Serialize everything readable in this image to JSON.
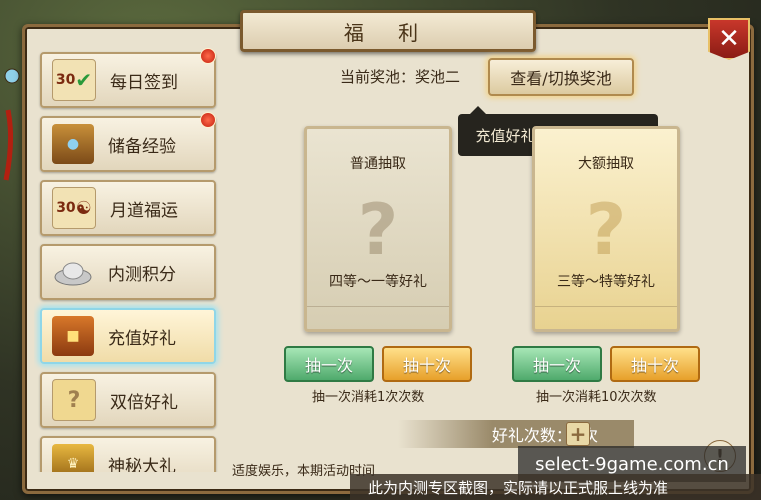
{
  "title": "福 利",
  "close_label": "✕",
  "sidebar": {
    "items": [
      {
        "label": "每日签到",
        "icon": "calendar-check-icon",
        "icon_text": "30",
        "badge": true
      },
      {
        "label": "储备经验",
        "icon": "treasure-chest-icon",
        "icon_text": "",
        "badge": true
      },
      {
        "label": "月道福运",
        "icon": "calendar-yinyang-icon",
        "icon_text": "30",
        "badge": false
      },
      {
        "label": "内测积分",
        "icon": "silver-ingot-icon",
        "icon_text": "",
        "badge": false
      },
      {
        "label": "充值好礼",
        "icon": "gift-chest-icon",
        "icon_text": "",
        "badge": false,
        "active": true
      },
      {
        "label": "双倍好礼",
        "icon": "question-card-icon",
        "icon_text": "?",
        "badge": false
      },
      {
        "label": "神秘大礼",
        "icon": "trophy-chest-icon",
        "icon_text": "",
        "badge": false
      }
    ]
  },
  "pool": {
    "current_label": "当前奖池：奖池二",
    "switch_button": "查看/切换奖池",
    "tooltip": "充值好礼奖池可随心切换"
  },
  "cards": [
    {
      "title": "普通抽取",
      "mark": "?",
      "subtitle": "四等～一等好礼"
    },
    {
      "title": "大额抽取",
      "mark": "?",
      "subtitle": "三等～特等好礼"
    }
  ],
  "buttons": {
    "draw_once": "抽一次",
    "draw_ten": "抽十次"
  },
  "costs": [
    "抽一次消耗1次次数",
    "抽一次消耗10次次数"
  ],
  "gift_count": "好礼次数：0次",
  "plus_label": "+",
  "info_label": "!",
  "footer_text": "适度娱乐，本期活动时间",
  "watermark": "select-9game.com.cn",
  "notice": "此为内测专区截图，实际请以正式服上线为准",
  "colors": {
    "frame": "#e9e2cf",
    "border": "#8b6a3e",
    "active_glow": "#9fe3f2",
    "badge_red": "#c22010",
    "green_button": "#4faa6c",
    "orange_button": "#e7a02a"
  }
}
